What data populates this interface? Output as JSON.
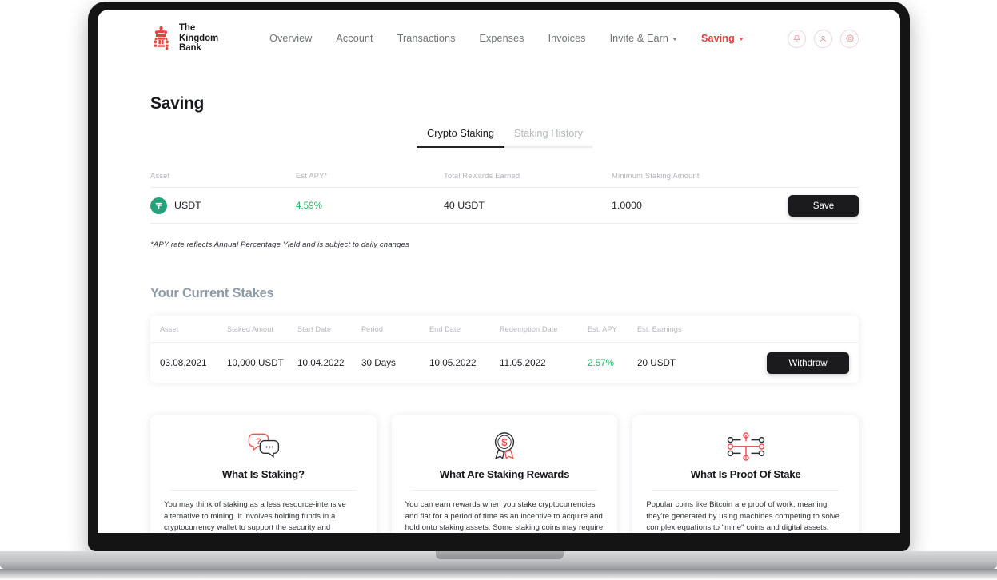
{
  "brand": {
    "line1": "The",
    "line2": "Kingdom",
    "line3": "Bank",
    "color": "#e8403a"
  },
  "nav": {
    "items": [
      {
        "label": "Overview",
        "active": false,
        "caret": false
      },
      {
        "label": "Account",
        "active": false,
        "caret": false
      },
      {
        "label": "Transactions",
        "active": false,
        "caret": false
      },
      {
        "label": "Expenses",
        "active": false,
        "caret": false
      },
      {
        "label": "Invoices",
        "active": false,
        "caret": false
      },
      {
        "label": "Invite & Earn",
        "active": false,
        "caret": true
      },
      {
        "label": "Saving",
        "active": true,
        "caret": true
      }
    ],
    "icons": [
      "bell-icon",
      "user-icon",
      "gear-icon"
    ]
  },
  "page": {
    "title": "Saving"
  },
  "tabs": [
    {
      "label": "Crypto Staking",
      "active": true
    },
    {
      "label": "Staking History",
      "active": false
    }
  ],
  "staking_table": {
    "headers": [
      "Asset",
      "Est APY*",
      "Total Rewards Earned",
      "Minimum Staking Amount"
    ],
    "row": {
      "asset": "USDT",
      "asset_icon": "tether-icon",
      "asset_color": "#26a17b",
      "est_apy": "4.59%",
      "apy_color": "#1fb563",
      "total_rewards": "40 USDT",
      "minimum": "1.0000",
      "action_label": "Save"
    },
    "note": "*APY rate reflects Annual Percentage Yield and is subject to daily changes"
  },
  "current_stakes": {
    "title": "Your Current Stakes",
    "headers": [
      "Asset",
      "Staked Amout",
      "Start Date",
      "Period",
      "End Date",
      "Redemption Date",
      "Est. APY",
      "Est. Earnings"
    ],
    "rows": [
      {
        "asset": "03.08.2021",
        "staked_amount": "10,000 USDT",
        "start_date": "10.04.2022",
        "period": "30 Days",
        "end_date": "10.05.2022",
        "redemption_date": "11.05.2022",
        "est_apy": "2.57%",
        "est_earnings": "20 USDT",
        "action_label": "Withdraw"
      }
    ]
  },
  "info_cards": [
    {
      "icon": "speech-bubbles-question-icon",
      "title": "What Is Staking?",
      "body": "You may think of staking as a less resource-intensive alternative to mining. It involves holding funds in a cryptocurrency wallet to support the security and operations of a blockchain network. Simply put, staking is the act of locking cryptocurrencies to recieve rewards."
    },
    {
      "icon": "award-dollar-icon",
      "title": "What Are Staking Rewards",
      "body": "You can earn rewards when you stake cryptocurrencies and fiat for a period of time as an incentive to acquire and hold onto staking assets. Some staking coins may require a bonding period. To earn staking rewards, simply select the asset you wish to stake and once it has finished"
    },
    {
      "icon": "network-nodes-icon",
      "title": "What Is Proof Of Stake",
      "body": "Popular coins like Bitcoin are proof of work, meaning they're generated by using machines competing to solve complex equations to \"mine\" coins and digital assets. Proof of Stake works differently by choosing from a pool of people holding the Proof of Stake coin. A Proof of Stake \"validator node\" can be added to the pool by staking coins"
    }
  ]
}
